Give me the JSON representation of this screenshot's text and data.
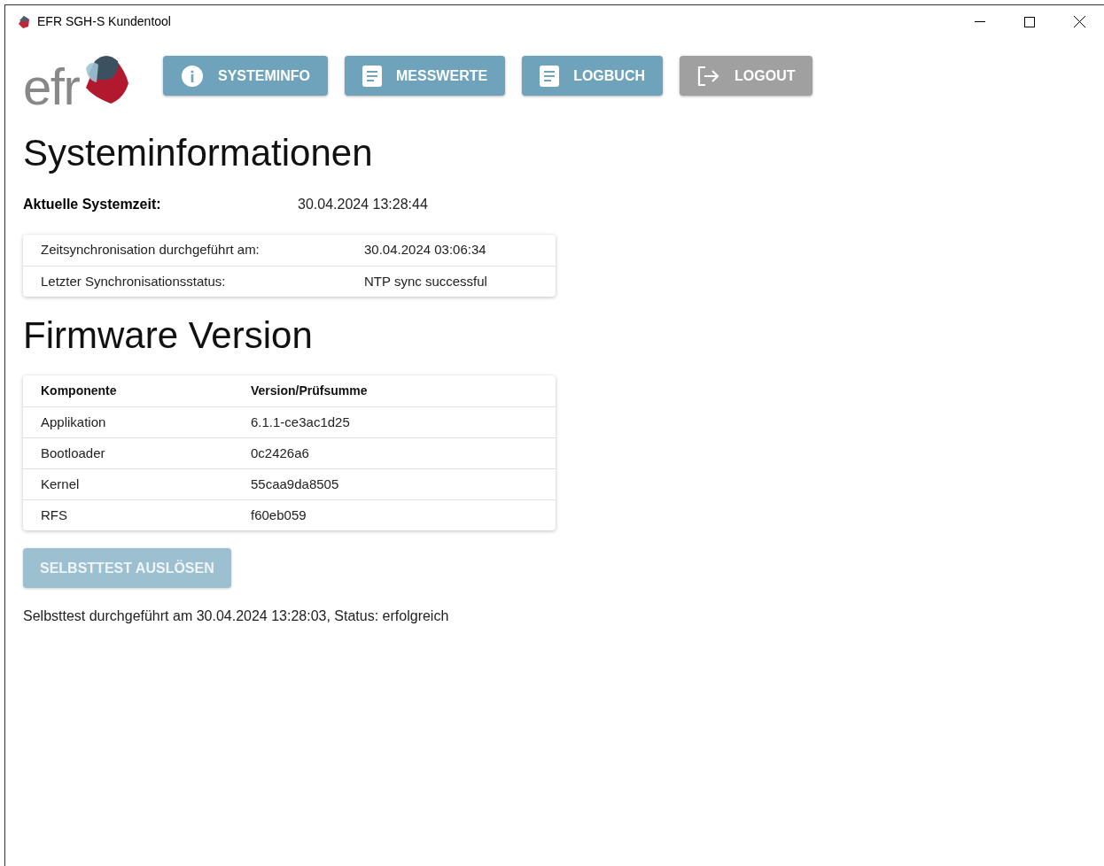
{
  "window": {
    "title": "EFR SGH-S Kundentool"
  },
  "logo": {
    "text": "efr"
  },
  "nav": [
    {
      "label": "SYSTEMINFO",
      "kind": "info",
      "disabled": false
    },
    {
      "label": "MESSWERTE",
      "kind": "document",
      "disabled": false
    },
    {
      "label": "LOGBUCH",
      "kind": "document",
      "disabled": false
    },
    {
      "label": "LOGOUT",
      "kind": "logout",
      "disabled": true
    }
  ],
  "system_info": {
    "heading": "Systeminformationen",
    "time_label": "Aktuelle Systemzeit:",
    "time_value": "30.04.2024 13:28:44",
    "sync_rows": [
      {
        "label": "Zeitsynchronisation durchgeführt am:",
        "value": "30.04.2024 03:06:34"
      },
      {
        "label": "Letzter Synchronisationsstatus:",
        "value": "NTP sync successful"
      }
    ]
  },
  "firmware": {
    "heading": "Firmware Version",
    "columns": [
      "Komponente",
      "Version/Prüfsumme"
    ],
    "rows": [
      [
        "Applikation",
        "6.1.1-ce3ac1d25"
      ],
      [
        "Bootloader",
        "0c2426a6"
      ],
      [
        "Kernel",
        "55caa9da8505"
      ],
      [
        "RFS",
        "f60eb059"
      ]
    ]
  },
  "selftest": {
    "button": {
      "label": "SELBSTTEST AUSLÖSEN",
      "disabled": true
    },
    "status": "Selbsttest durchgeführt am 30.04.2024 13:28:03, Status: erfolgreich"
  }
}
